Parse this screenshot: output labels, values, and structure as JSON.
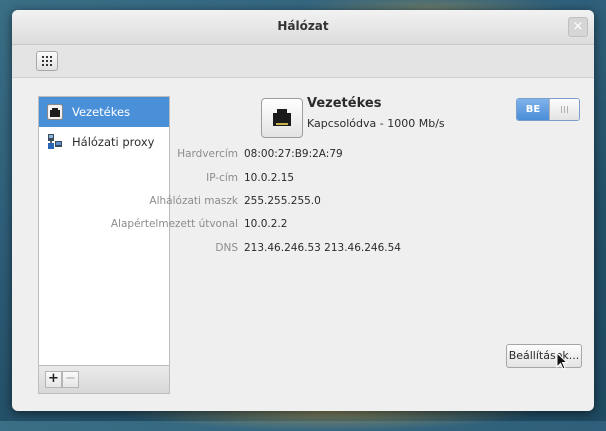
{
  "window": {
    "title": "Hálózat"
  },
  "toolbar": {
    "grid_icon": "grid-icon"
  },
  "sidebar": {
    "items": [
      {
        "label": "Vezetékes",
        "icon": "wired-network-icon",
        "selected": true
      },
      {
        "label": "Hálózati proxy",
        "icon": "proxy-icon",
        "selected": false
      }
    ],
    "add_label": "+",
    "remove_label": "−"
  },
  "connection": {
    "name": "Vezetékes",
    "status": "Kapcsolódva - 1000 Mb/s",
    "toggle_label": "BE",
    "enabled": true,
    "details": [
      {
        "label": "Hardvercím",
        "value": "08:00:27:B9:2A:79"
      },
      {
        "label": "IP-cím",
        "value": "10.0.2.15"
      },
      {
        "label": "Alhálózati maszk",
        "value": "255.255.255.0"
      },
      {
        "label": "Alapértelmezett útvonal",
        "value": "10.0.2.2"
      },
      {
        "label": "DNS",
        "value": "213.46.246.53 213.46.246.54"
      }
    ],
    "settings_label": "Beállítások..."
  },
  "colors": {
    "selection": "#4a90d9",
    "toggle_on": "#4a8dd8"
  }
}
